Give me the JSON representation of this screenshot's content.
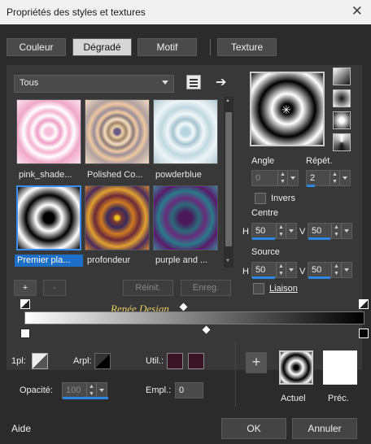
{
  "window": {
    "title": "Propriétés des styles et textures",
    "close": "✕"
  },
  "tabs": [
    {
      "label": "Couleur",
      "active": false
    },
    {
      "label": "Dégradé",
      "active": true
    },
    {
      "label": "Motif",
      "active": false
    },
    {
      "label": "Texture",
      "active": false
    }
  ],
  "category": {
    "selected": "Tous"
  },
  "gradients": [
    {
      "name": "pink_shade...",
      "selected": false
    },
    {
      "name": "Polished Co...",
      "selected": false
    },
    {
      "name": "powderblue",
      "selected": false
    },
    {
      "name": "Premier pla...",
      "selected": true
    },
    {
      "name": "profondeur",
      "selected": false
    },
    {
      "name": "purple and ..."
    }
  ],
  "list_buttons": {
    "add": "+",
    "remove": "-",
    "reset": "Réinit.",
    "save": "Enreg."
  },
  "angle": {
    "label": "Angle",
    "value": "0"
  },
  "repeat": {
    "label": "Répét.",
    "value": "2"
  },
  "invert": {
    "label": "Invers"
  },
  "center": {
    "label": "Centre",
    "h_label": "H",
    "h": "50",
    "v_label": "V",
    "v": "50"
  },
  "source": {
    "label": "Source",
    "h_label": "H",
    "h": "50",
    "v_label": "V",
    "v": "50"
  },
  "link": {
    "label": "Liaison"
  },
  "watermark": "Renée Design",
  "stop_options": {
    "onepl_label": "1pl:",
    "arpl_label": "Arpl:",
    "util_label": "Util.:",
    "opacity_label": "Opacité:",
    "opacity_value": "100",
    "empl_label": "Empl.:",
    "empl_value": "0"
  },
  "preview_labels": {
    "add": "+",
    "current": "Actuel",
    "previous": "Préc."
  },
  "footer": {
    "help": "Aide",
    "ok": "OK",
    "cancel": "Annuler"
  },
  "colors": {
    "accent": "#1e6fc8",
    "util_color_1": "#3a1525",
    "util_color_2": "#3a1525"
  }
}
